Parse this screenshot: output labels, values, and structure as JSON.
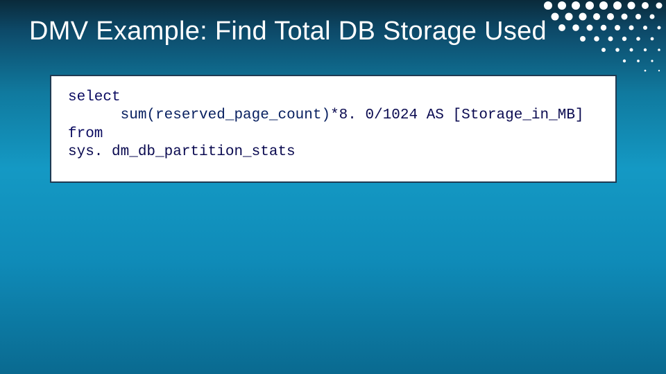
{
  "title": "DMV Example: Find Total DB Storage Used",
  "code": {
    "l1": "select",
    "l2_indent": "      ",
    "l2_func": "sum(reserved_page_count)",
    "l2_rest": "*8. 0/1024 AS [Storage_in_MB]",
    "l3": "from",
    "l4": "sys. dm_db_partition_stats"
  }
}
